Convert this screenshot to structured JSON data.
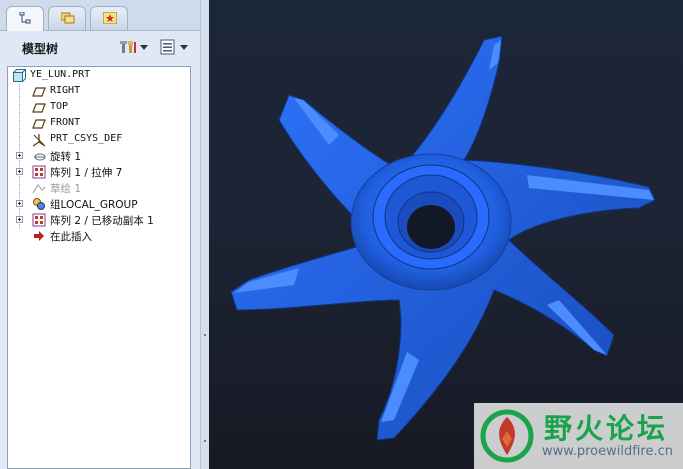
{
  "panel": {
    "title": "模型树",
    "tabs": [
      {
        "name": "model-tree-tab",
        "icon": "tree-icon",
        "active": true
      },
      {
        "name": "folder-browser-tab",
        "icon": "folders-icon",
        "active": false
      },
      {
        "name": "favorites-tab",
        "icon": "star-icon",
        "active": false
      }
    ],
    "tools": [
      {
        "icon": "settings-tools-icon"
      },
      {
        "icon": "show-list-icon"
      }
    ]
  },
  "tree": {
    "root": "YE_LUN.PRT",
    "items": [
      {
        "label": "RIGHT",
        "icon": "datum-plane-icon",
        "expandable": false,
        "dim": false
      },
      {
        "label": "TOP",
        "icon": "datum-plane-icon",
        "expandable": false,
        "dim": false
      },
      {
        "label": "FRONT",
        "icon": "datum-plane-icon",
        "expandable": false,
        "dim": false
      },
      {
        "label": "PRT_CSYS_DEF",
        "icon": "coordinate-system-icon",
        "expandable": false,
        "dim": false
      },
      {
        "label": "旋转 1",
        "icon": "revolve-icon",
        "expandable": true,
        "dim": false
      },
      {
        "label": "阵列 1 / 拉伸 7",
        "icon": "pattern-icon",
        "expandable": true,
        "dim": false
      },
      {
        "label": "草绘 1",
        "icon": "sketch-icon",
        "expandable": false,
        "dim": true
      },
      {
        "label": "组LOCAL_GROUP",
        "icon": "group-icon",
        "expandable": true,
        "dim": false
      },
      {
        "label": "阵列 2 / 已移动副本 1",
        "icon": "pattern-icon",
        "expandable": true,
        "dim": false
      },
      {
        "label": "在此插入",
        "icon": "insert-here-arrow-icon",
        "expandable": false,
        "dim": false
      }
    ]
  },
  "watermark": {
    "title": "野火论坛",
    "url": "www.proewildfire.cn"
  },
  "colors": {
    "part_blue": "#1f5fe0",
    "viewport_bg": "#1c2436",
    "watermark_green": "#1aa34a"
  }
}
